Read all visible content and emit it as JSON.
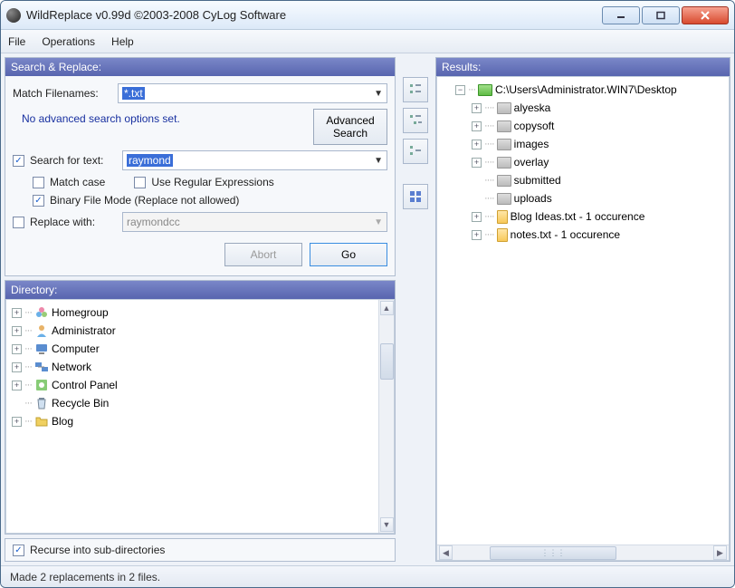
{
  "window": {
    "title": "WildReplace v0.99d ©2003-2008 CyLog Software"
  },
  "menu": {
    "file": "File",
    "operations": "Operations",
    "help": "Help"
  },
  "searchPanel": {
    "title": "Search & Replace:",
    "matchFilenamesLabel": "Match Filenames:",
    "matchFilenamesValue": "*.txt",
    "advNote": "No advanced search options set.",
    "advButton": "Advanced\nSearch",
    "searchForTextLabel": "Search for text:",
    "searchForTextValue": "raymond",
    "matchCaseLabel": "Match case",
    "useRegexLabel": "Use Regular Expressions",
    "binaryModeLabel": "Binary File Mode (Replace not allowed)",
    "replaceWithLabel": "Replace with:",
    "replaceWithValue": "raymondcc",
    "abortLabel": "Abort",
    "goLabel": "Go"
  },
  "directoryPanel": {
    "title": "Directory:",
    "items": [
      {
        "label": "Homegroup",
        "icon": "homegroup"
      },
      {
        "label": "Administrator",
        "icon": "user"
      },
      {
        "label": "Computer",
        "icon": "computer"
      },
      {
        "label": "Network",
        "icon": "network"
      },
      {
        "label": "Control Panel",
        "icon": "cpanel"
      },
      {
        "label": "Recycle Bin",
        "icon": "recycle"
      },
      {
        "label": "Blog",
        "icon": "folder"
      }
    ],
    "recurseLabel": "Recurse into sub-directories"
  },
  "resultsPanel": {
    "title": "Results:",
    "rootLabel": "C:\\Users\\Administrator.WIN7\\Desktop",
    "items": [
      {
        "type": "folder",
        "label": "alyeska",
        "expandable": true
      },
      {
        "type": "folder",
        "label": "copysoft",
        "expandable": true
      },
      {
        "type": "folder",
        "label": "images",
        "expandable": true
      },
      {
        "type": "folder",
        "label": "overlay",
        "expandable": true
      },
      {
        "type": "folder",
        "label": "submitted",
        "expandable": false
      },
      {
        "type": "folder",
        "label": "uploads",
        "expandable": false
      },
      {
        "type": "file",
        "label": "Blog Ideas.txt - 1 occurence",
        "expandable": true
      },
      {
        "type": "file",
        "label": "notes.txt - 1 occurence",
        "expandable": true
      }
    ]
  },
  "status": {
    "text": "Made 2 replacements in 2 files."
  }
}
